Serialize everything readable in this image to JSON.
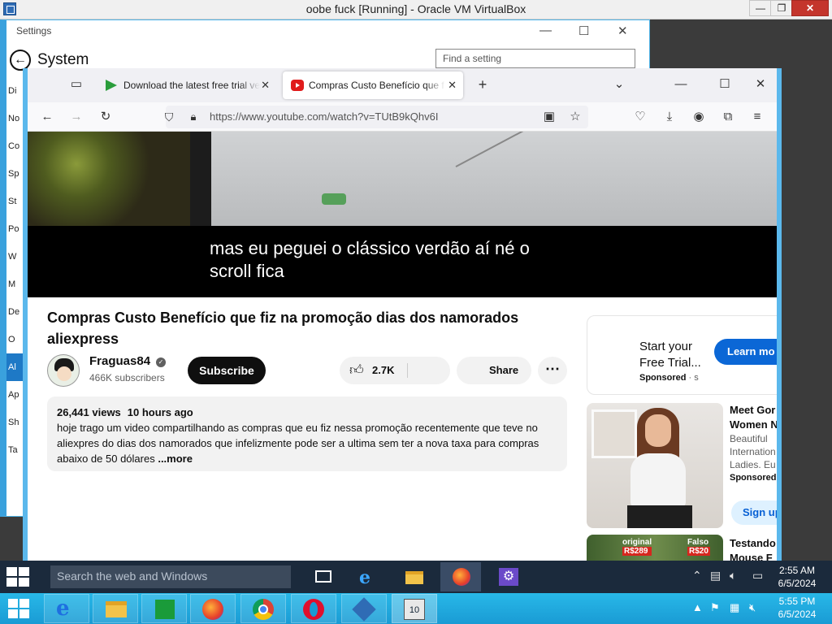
{
  "host": {
    "title": "oobe fuck [Running] - Oracle VM VirtualBox",
    "controls": {
      "minimize": "—",
      "restore": "❐",
      "close": "✕"
    },
    "taskbar": {
      "apps": [
        "internet-explorer",
        "file-explorer",
        "store",
        "firefox",
        "chrome",
        "opera",
        "virtualbox",
        "virtualbox-vm"
      ],
      "time": "5:55 PM",
      "date": "6/5/2024"
    }
  },
  "settings": {
    "title": "Settings",
    "heading": "System",
    "search_placeholder": "Find a setting",
    "nav": [
      "Di",
      "No",
      "Co",
      "Sp",
      "St",
      "Po",
      "W",
      "M",
      "De",
      "O",
      "Al",
      "Ap",
      "Sh",
      "Ta"
    ],
    "selected_nav_index": 10
  },
  "firefox": {
    "tabs": [
      {
        "label": "Download the latest free trial ve",
        "active": false
      },
      {
        "label": "Compras Custo Benefício que f",
        "active": true
      }
    ],
    "new_tab": "+",
    "url": "https://www.youtube.com/watch?v=TUtB9kQhv6I"
  },
  "youtube": {
    "caption_line1": "mas eu peguei o clássico verdão aí né o",
    "caption_line2": "scroll fica",
    "video_title": "Compras Custo Benefício que fiz na promoção dias dos namorados aliexpress",
    "channel": "Fraguas84",
    "subscribers": "466K subscribers",
    "subscribe_label": "Subscribe",
    "likes": "2.7K",
    "share_label": "Share",
    "more_label": "⋯",
    "views": "26,441 views",
    "posted": "10 hours ago",
    "description": "hoje trago um video compartilhando as compras que eu fiz nessa promoção recentemente que teve no aliexpres do dias dos namorados que infelizmente pode ser a ultima sem ter a nova taxa para compras abaixo de 50 dólares",
    "more_link": "...more",
    "ad": {
      "title": "Start your Free Trial...",
      "sponsored": "Sponsored",
      "sponsored_suffix": " · s",
      "button": "Learn mo"
    },
    "rec1": {
      "title_line1": "Meet Gor",
      "title_line2": "Women N",
      "line1": "Beautiful",
      "line2": "Internation",
      "line3": "Ladies. Eu",
      "sponsored": "Sponsored",
      "button": "Sign up"
    },
    "rec2": {
      "title_line1": "Testando",
      "title_line2": "Mouse F",
      "price1_label": "original",
      "price1": "R$289",
      "price2_label": "Falso",
      "price2": "R$20"
    }
  },
  "guest": {
    "search_placeholder": "Search the web and Windows",
    "time": "2:55 AM",
    "date": "6/5/2024"
  }
}
